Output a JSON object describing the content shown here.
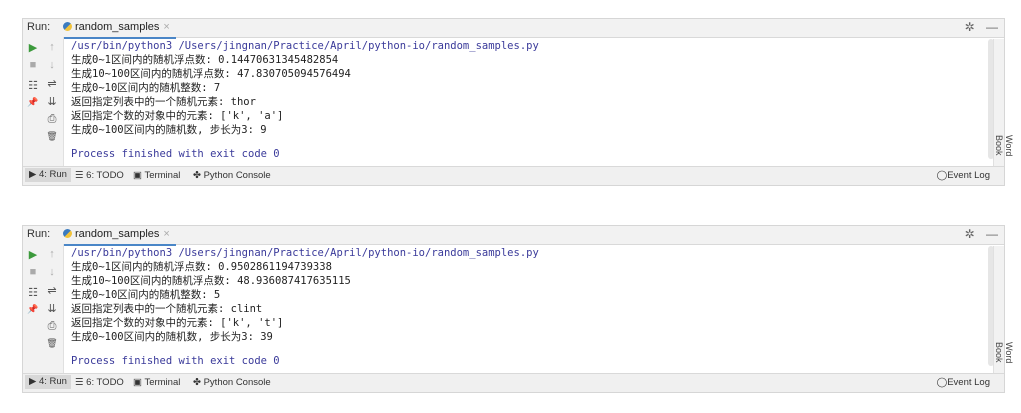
{
  "panels": [
    {
      "run_label": "Run:",
      "tab_title": "random_samples",
      "tab_close": "×",
      "lines": [
        "/usr/bin/python3 /Users/jingnan/Practice/April/python-io/random_samples.py",
        "生成0~1区间内的随机浮点数: 0.14470631345482854",
        "生成10~100区间内的随机浮点数: 47.830705094576494",
        "生成0~10区间内的随机整数: 7",
        "返回指定列表中的一个随机元素: thor",
        "返回指定个数的对象中的元素: ['k', 'a']",
        "生成0~100区间内的随机数, 步长为3: 9"
      ],
      "finished": "Process finished with exit code 0"
    },
    {
      "run_label": "Run:",
      "tab_title": "random_samples",
      "tab_close": "×",
      "lines": [
        "/usr/bin/python3 /Users/jingnan/Practice/April/python-io/random_samples.py",
        "生成0~1区间内的随机浮点数: 0.9502861194739338",
        "生成10~100区间内的随机浮点数: 48.936087417635115",
        "生成0~10区间内的随机整数: 5",
        "返回指定列表中的一个随机元素: clint",
        "返回指定个数的对象中的元素: ['k', 't']",
        "生成0~100区间内的随机数, 步长为3: 39"
      ],
      "finished": "Process finished with exit code 0"
    }
  ],
  "header_icons": {
    "settings": "✲",
    "minimize": "—"
  },
  "gutter_icons": {
    "run": "▶",
    "up": "↑",
    "stop": "■",
    "down": "↓",
    "layout": "☷",
    "wrap": "⇌",
    "pin": "📌",
    "scroll_end": "⇊",
    "print": "⎙",
    "trash": "🗑"
  },
  "status_bar": {
    "run_tab": "▶ 4: Run",
    "todo_tab": "☰ 6: TODO",
    "terminal_tab": "▣ Terminal",
    "python_console_tab": "✤ Python Console",
    "event_log": "Event Log"
  },
  "sidebar": {
    "word_book": "Word Book"
  },
  "colors": {
    "accent": "#4a86c7",
    "run_green": "#3c9a3c",
    "console_text": "#3a3a9a"
  }
}
